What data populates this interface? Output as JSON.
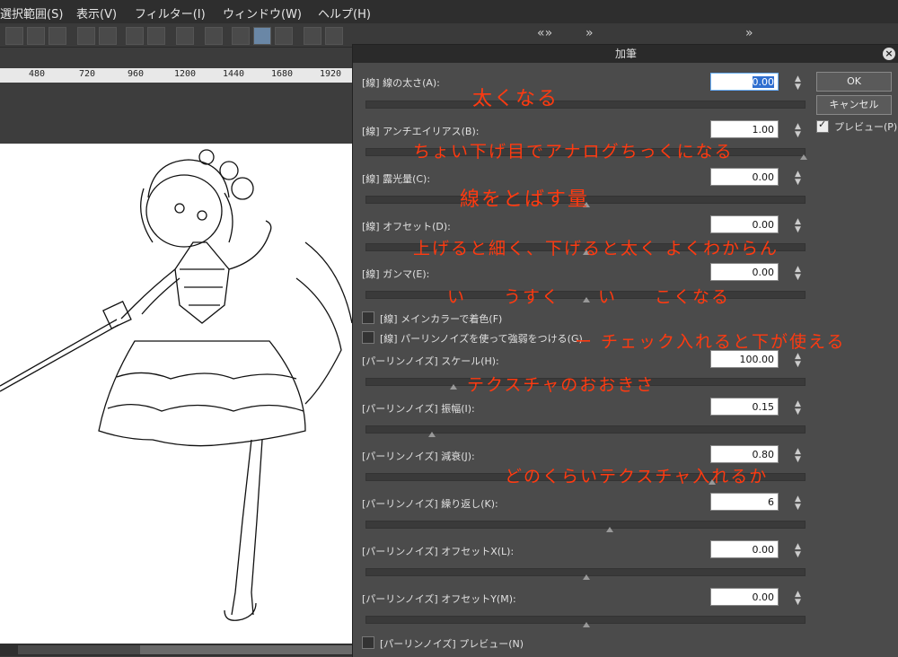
{
  "menu": {
    "items": [
      "選択範囲(S)",
      "表示(V)",
      "フィルター(I)",
      "ウィンドウ(W)",
      "ヘルプ(H)"
    ]
  },
  "ruler": {
    "ticks": [
      "480",
      "720",
      "960",
      "1200",
      "1440",
      "1680",
      "1920"
    ]
  },
  "dialog": {
    "title": "加筆",
    "ok_label": "OK",
    "cancel_label": "キャンセル",
    "preview_label": "プレビュー(P)",
    "preview_checked": true,
    "params": [
      {
        "label": "[線] 線の太さ(A):",
        "value": "0.00",
        "selected": true
      },
      {
        "label": "[線] アンチエイリアス(B):",
        "value": "1.00"
      },
      {
        "label": "[線] 露光量(C):",
        "value": "0.00"
      },
      {
        "label": "[線] オフセット(D):",
        "value": "0.00"
      },
      {
        "label": "[線] ガンマ(E):",
        "value": "0.00"
      },
      {
        "label": "[パーリンノイズ] スケール(H):",
        "value": "100.00"
      },
      {
        "label": "[パーリンノイズ] 振幅(I):",
        "value": "0.15"
      },
      {
        "label": "[パーリンノイズ] 減衰(J):",
        "value": "0.80"
      },
      {
        "label": "[パーリンノイズ] 繰り返し(K):",
        "value": "6"
      },
      {
        "label": "[パーリンノイズ] オフセットX(L):",
        "value": "0.00"
      },
      {
        "label": "[パーリンノイズ] オフセットY(M):",
        "value": "0.00"
      }
    ],
    "checkboxes": [
      {
        "label": "[線] メインカラーで着色(F)"
      },
      {
        "label": "[線] パーリンノイズを使って強弱をつける(G)"
      },
      {
        "label": "[パーリンノイズ] プレビュー(N)"
      }
    ]
  },
  "annotations": [
    "太くなる",
    "ちょい下げ目でアナログちっくになる",
    "線をとばす量",
    "上げると細く、下げると太く よくわからん",
    "い　　うすく　　い　　こくなる",
    "ー チェック入れると下が使える",
    "テクスチャのおおきさ",
    "どのくらいテクスチャ入れるか"
  ],
  "colors": {
    "annotation": "#ff3a10",
    "dialog_bg": "#4b4b4b",
    "accent": "#2f6fd0"
  }
}
